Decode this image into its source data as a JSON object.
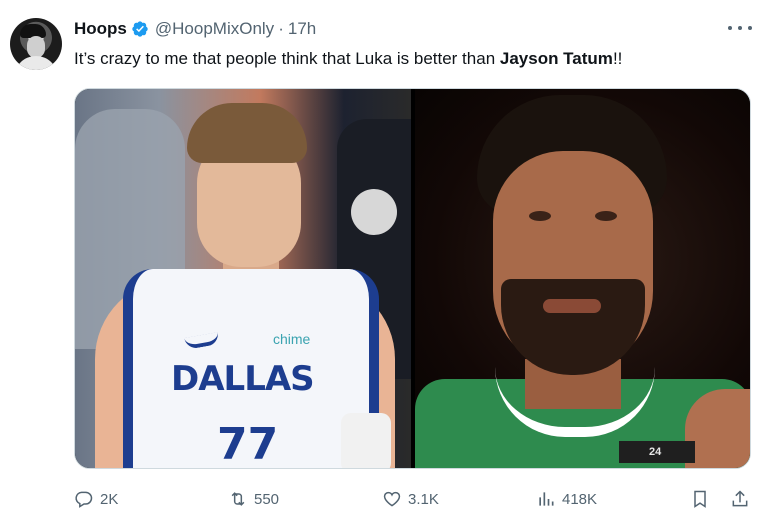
{
  "tweet": {
    "author_name": "Hoops",
    "handle": "@HoopMixOnly",
    "separator": "·",
    "time": "17h",
    "text_before": "It’s crazy to me that people think that Luka is better than ",
    "text_bold": "Jayson Tatum",
    "text_after": "!!",
    "verified_color": "#1d9bf0",
    "left_photo": {
      "jersey_text": "DALLAS",
      "jersey_number": "77",
      "sponsor": "chime"
    },
    "right_photo": {
      "patch_number": "24"
    }
  },
  "actions": {
    "reply": {
      "icon": "reply-icon",
      "count": "2K"
    },
    "repost": {
      "icon": "repost-icon",
      "count": "550"
    },
    "like": {
      "icon": "like-icon",
      "count": "3.1K"
    },
    "views": {
      "icon": "views-icon",
      "count": "418K"
    },
    "bookmark": {
      "icon": "bookmark-icon"
    },
    "share": {
      "icon": "share-icon"
    }
  },
  "colors": {
    "text": "#0f1419",
    "muted": "#536471",
    "accent": "#1d9bf0"
  }
}
